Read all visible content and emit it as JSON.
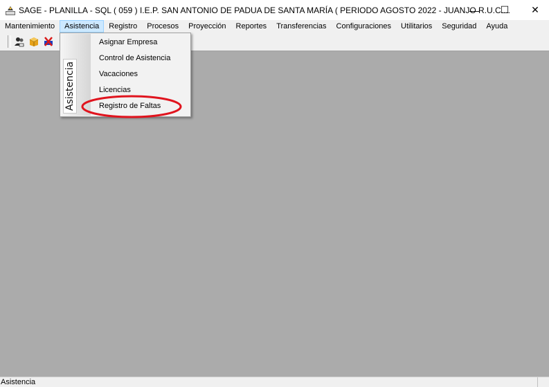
{
  "window": {
    "title": "SAGE - PLANILLA - SQL  ( 059 ) I.E.P. SAN ANTONIO DE PADUA DE SANTA MARÍA ( PERIODO AGOSTO 2022 - JUANJO  R.U.C....",
    "controls": {
      "minimize": "—",
      "maximize": "☐",
      "close": "✕"
    }
  },
  "menubar": {
    "items": [
      "Mantenimiento",
      "Asistencia",
      "Registro",
      "Procesos",
      "Proyección",
      "Reportes",
      "Transferencias",
      "Configuraciones",
      "Utilitarios",
      "Seguridad",
      "Ayuda"
    ],
    "active": "Asistencia"
  },
  "toolbar": {
    "buttons": [
      "users-icon",
      "box-icon",
      "exit-icon"
    ]
  },
  "dropdown": {
    "banner": "Asistencia",
    "items": [
      "Asignar Empresa",
      "Control de Asistencia",
      "Vacaciones",
      "Licencias",
      "Registro de Faltas"
    ],
    "highlighted": "Registro de Faltas",
    "highlight_color": "#e0141e"
  },
  "status": {
    "text": "Asistencia"
  }
}
